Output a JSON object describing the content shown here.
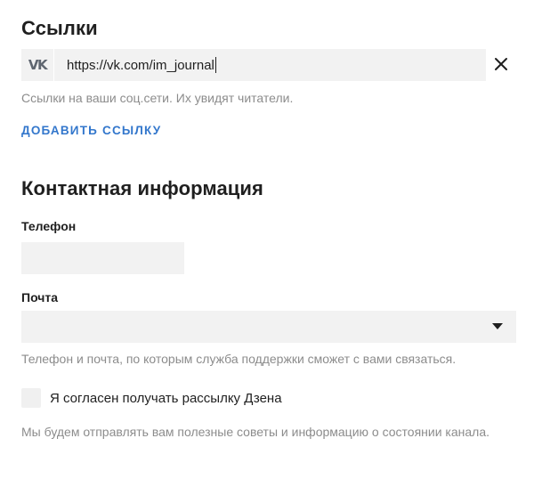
{
  "links_section": {
    "title": "Ссылки",
    "social_icon_text": "VK",
    "link_value": "https://vk.com/im_journal",
    "hint": "Ссылки на ваши соц.сети. Их увидят читатели.",
    "add_link_label": "ДОБАВИТЬ ССЫЛКУ"
  },
  "contact_section": {
    "title": "Контактная информация",
    "phone_label": "Телефон",
    "phone_value": "",
    "email_label": "Почта",
    "email_selected": "",
    "hint": "Телефон и почта, по которым служба поддержки сможет с вами связаться.",
    "newsletter_label": "Я согласен получать рассылку Дзена",
    "newsletter_checked": false,
    "newsletter_hint": "Мы будем отправлять вам полезные советы и информацию о состоянии канала."
  },
  "colors": {
    "accent": "#3377cc",
    "field_bg": "#f2f2f2",
    "hint_text": "#8c8c8c"
  }
}
